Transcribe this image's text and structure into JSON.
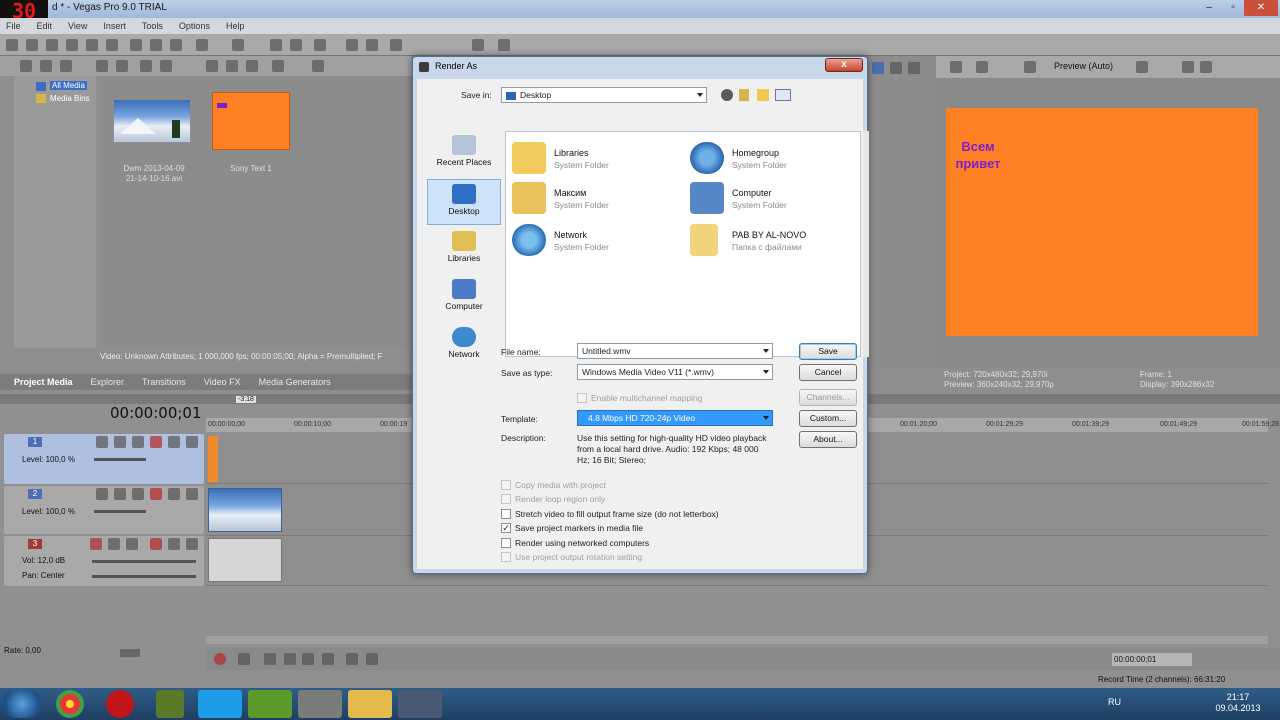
{
  "app": {
    "fps_overlay": "30",
    "title": "d * - Vegas Pro 9.0 TRIAL",
    "menu": [
      "File",
      "Edit",
      "View",
      "Insert",
      "Tools",
      "Options",
      "Help"
    ]
  },
  "project_media": {
    "tree": [
      "All Media",
      "Media Bins"
    ],
    "items": [
      {
        "label_line1": "Dwm 2013-04-09",
        "label_line2": "21-14-10-16.avi",
        "thumb": "winter-landscape"
      },
      {
        "label_line1": "Sony Text 1",
        "label_line2": "",
        "thumb": "orange-text"
      }
    ],
    "status": "Video: Unknown Attributes; 1 000,000 fps; 00:00:05;00; Alpha = Premultiplied; F",
    "tabs": [
      "Project Media",
      "Explorer",
      "Transitions",
      "Video FX",
      "Media Generators"
    ],
    "active_tab": "Project Media"
  },
  "preview": {
    "mode": "Preview (Auto)",
    "overlay_text_line1": "Всем",
    "overlay_text_line2": "привет",
    "frame_color": "#ff7f24",
    "text_color": "#7b1fd1",
    "info": {
      "project": "Project:   720x480x32; 29,970i",
      "preview": "Preview:   360x240x32; 29,970p",
      "frame": "Frame:      1",
      "display": "Display:    390x286x32"
    }
  },
  "timeline": {
    "timecode": "00:00:00;01",
    "marker": "-3:18",
    "ruler": [
      "00:00:00;00",
      "00:00:10;00",
      "00:00:19",
      "00:01:20;00",
      "00:01:29;29",
      "00:01:39;29",
      "00:01:49;29",
      "00:01:59;28"
    ],
    "tracks": [
      {
        "number": "1",
        "level": "Level: 100,0 %",
        "color": "#4e6fb5"
      },
      {
        "number": "2",
        "level": "Level: 100,0 %",
        "color": "#4e6fb5"
      },
      {
        "number": "3",
        "vol": "Vol:     12,0 dB",
        "pan": "Pan:     Center",
        "color": "#a33a3a"
      }
    ],
    "rate": "Rate: 0,00",
    "end_timecode": "00:00:00;01",
    "record_time": "Record Time (2 channels): 66:31:20"
  },
  "dialog": {
    "title": "Render As",
    "close_label": "x",
    "save_in_label": "Save in:",
    "save_in_value": "Desktop",
    "places": [
      {
        "label": "Recent Places",
        "icon": "recent-places-icon"
      },
      {
        "label": "Desktop",
        "icon": "desktop-icon"
      },
      {
        "label": "Libraries",
        "icon": "libraries-icon"
      },
      {
        "label": "Computer",
        "icon": "computer-icon"
      },
      {
        "label": "Network",
        "icon": "network-icon"
      }
    ],
    "active_place": "Desktop",
    "files": [
      {
        "name": "Libraries",
        "type": "System Folder",
        "icon": "libraries-folder-icon"
      },
      {
        "name": "Homegroup",
        "type": "System Folder",
        "icon": "homegroup-icon"
      },
      {
        "name": "Максим",
        "type": "System Folder",
        "icon": "user-folder-icon"
      },
      {
        "name": "Computer",
        "type": "System Folder",
        "icon": "computer-icon"
      },
      {
        "name": "Network",
        "type": "System Folder",
        "icon": "network-icon"
      },
      {
        "name": "PAB BY AL-NOVO",
        "type": "Папка с файлами",
        "icon": "folder-icon"
      }
    ],
    "file_name_label": "File name:",
    "file_name_value": "Untitled.wmv",
    "save_as_type_label": "Save as type:",
    "save_as_type_value": "Windows Media Video V11 (*.wmv)",
    "multichannel_label": "Enable multichannel mapping",
    "template_label": "Template:",
    "template_value": "4.8 Mbps HD 720-24p Video",
    "description_label": "Description:",
    "description_text": "Use this setting for high-quality HD video playback from a local hard drive. Audio: 192 Kbps; 48 000 Hz; 16 Bit; Stereo;",
    "buttons": {
      "save": "Save",
      "cancel": "Cancel",
      "channels": "Channels...",
      "custom": "Custom...",
      "about": "About..."
    },
    "options": [
      {
        "label": "Copy media with project",
        "checked": false,
        "disabled": true
      },
      {
        "label": "Render loop region only",
        "checked": false,
        "disabled": true
      },
      {
        "label": "Stretch video to fill output frame size (do not letterbox)",
        "checked": false,
        "disabled": false
      },
      {
        "label": "Save project markers in media file",
        "checked": true,
        "disabled": false
      },
      {
        "label": "Render using networked computers",
        "checked": false,
        "disabled": false
      },
      {
        "label": "Use project output rotation setting",
        "checked": false,
        "disabled": true
      }
    ]
  },
  "taskbar": {
    "lang": "RU",
    "time": "21:17",
    "date": "09.04.2013",
    "apps": [
      "start-orb-icon",
      "chrome-icon",
      "record-icon",
      "minecraft-icon",
      "skype-icon",
      "utorrent-icon",
      "monitor-icon",
      "explorer-icon",
      "vegas-icon"
    ]
  }
}
